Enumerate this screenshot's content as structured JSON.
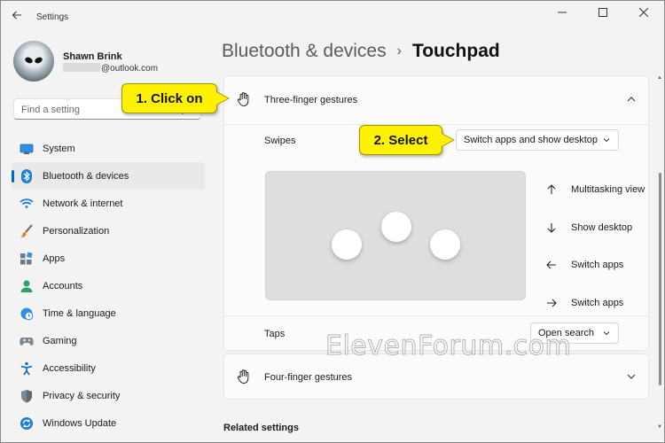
{
  "window": {
    "title": "Settings",
    "controls": [
      "minimize",
      "maximize",
      "close"
    ]
  },
  "profile": {
    "name": "Shawn Brink",
    "email_suffix": "@outlook.com"
  },
  "search": {
    "placeholder": "Find a setting"
  },
  "sidebar": {
    "items": [
      {
        "label": "System",
        "icon": "monitor-icon"
      },
      {
        "label": "Bluetooth & devices",
        "icon": "bluetooth-icon",
        "active": true
      },
      {
        "label": "Network & internet",
        "icon": "wifi-icon"
      },
      {
        "label": "Personalization",
        "icon": "paintbrush-icon"
      },
      {
        "label": "Apps",
        "icon": "apps-icon"
      },
      {
        "label": "Accounts",
        "icon": "person-icon"
      },
      {
        "label": "Time & language",
        "icon": "clock-globe-icon"
      },
      {
        "label": "Gaming",
        "icon": "gamepad-icon"
      },
      {
        "label": "Accessibility",
        "icon": "accessibility-icon"
      },
      {
        "label": "Privacy & security",
        "icon": "shield-icon"
      },
      {
        "label": "Windows Update",
        "icon": "sync-icon"
      }
    ]
  },
  "header": {
    "parent": "Bluetooth & devices",
    "separator": "›",
    "current": "Touchpad"
  },
  "three_finger": {
    "title": "Three-finger gestures",
    "expanded": true,
    "swipes_label": "Swipes",
    "swipes_value": "Switch apps and show desktop",
    "gestures": [
      {
        "direction": "up",
        "label": "Multitasking view"
      },
      {
        "direction": "down",
        "label": "Show desktop"
      },
      {
        "direction": "left",
        "label": "Switch apps"
      },
      {
        "direction": "right",
        "label": "Switch apps"
      }
    ],
    "taps_label": "Taps",
    "taps_value": "Open search"
  },
  "four_finger": {
    "title": "Four-finger gestures",
    "expanded": false
  },
  "related_settings": "Related settings",
  "callouts": {
    "step1": "1. Click on",
    "step2": "2. Select"
  },
  "watermark": "ElevenForum.com",
  "colors": {
    "accent": "#0067c0",
    "callout": "#fff200",
    "background": "#f3f3f3"
  }
}
